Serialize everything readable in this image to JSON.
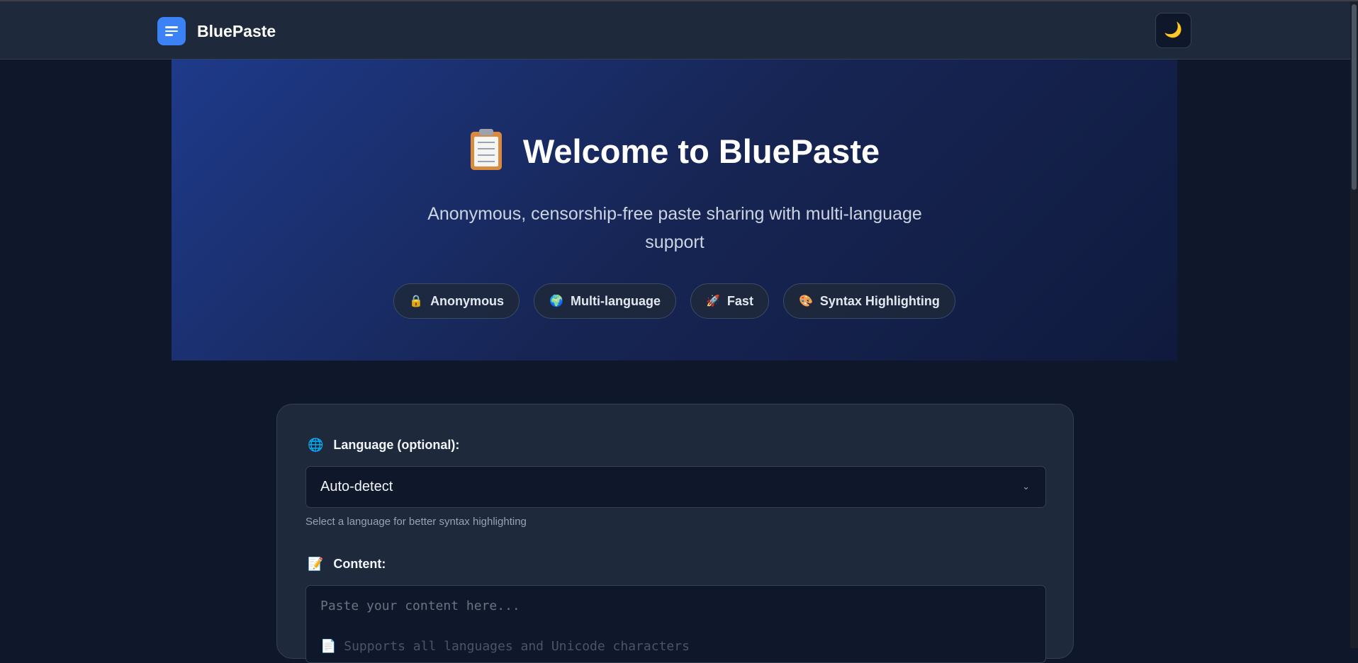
{
  "header": {
    "brand_name": "BluePaste",
    "theme_toggle_glyph": "🌙"
  },
  "hero": {
    "title": "Welcome to BluePaste",
    "subtitle": "Anonymous, censorship-free paste sharing with multi-language support",
    "features": [
      {
        "icon": "🔒",
        "label": "Anonymous"
      },
      {
        "icon": "🌍",
        "label": "Multi-language"
      },
      {
        "icon": "🚀",
        "label": "Fast"
      },
      {
        "icon": "🎨",
        "label": "Syntax Highlighting"
      }
    ]
  },
  "form": {
    "language_icon": "🌐",
    "language_label": "Language (optional):",
    "language_selected": "Auto-detect",
    "language_hint": "Select a language for better syntax highlighting",
    "content_icon": "📝",
    "content_label": "Content:",
    "content_placeholder": "Paste your content here...",
    "content_placeholder_line2": "📄 Supports all languages and Unicode characters"
  },
  "colors": {
    "accent": "#3b82f6",
    "background": "#0f172a",
    "surface": "#1e293b"
  }
}
